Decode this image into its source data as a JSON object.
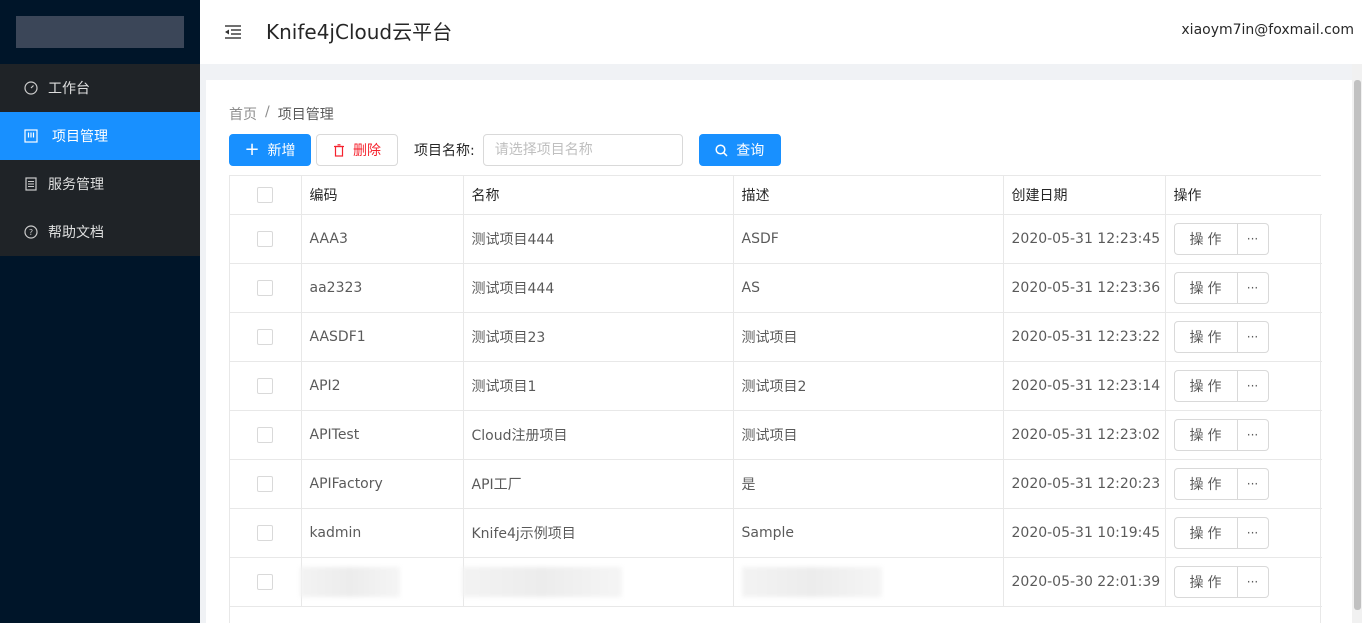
{
  "app": {
    "title": "Knife4jCloud云平台",
    "user": "xiaoym7in@foxmail.com"
  },
  "sidebar": {
    "items": [
      {
        "label": "工作台",
        "icon": "dashboard-icon",
        "active": false
      },
      {
        "label": "项目管理",
        "icon": "project-icon",
        "active": true
      },
      {
        "label": "服务管理",
        "icon": "service-icon",
        "active": false
      },
      {
        "label": "帮助文档",
        "icon": "help-icon",
        "active": false
      }
    ]
  },
  "breadcrumb": {
    "home": "首页",
    "sep": "/",
    "current": "项目管理"
  },
  "toolbar": {
    "add_label": "新增",
    "delete_label": "删除",
    "name_label": "项目名称:",
    "name_placeholder": "请选择项目名称",
    "query_label": "查询"
  },
  "table": {
    "columns": [
      "编码",
      "名称",
      "描述",
      "创建日期",
      "操作"
    ],
    "op_label": "操作",
    "more_label": "···",
    "rows": [
      {
        "code": "AAA3",
        "name": "测试项目444",
        "desc": "ASDF",
        "date": "2020-05-31 12:23:45"
      },
      {
        "code": "aa2323",
        "name": "测试项目444",
        "desc": "AS",
        "date": "2020-05-31 12:23:36"
      },
      {
        "code": "AASDF1",
        "name": "测试项目23",
        "desc": "测试项目",
        "date": "2020-05-31 12:23:22"
      },
      {
        "code": "API2",
        "name": "测试项目1",
        "desc": "测试项目2",
        "date": "2020-05-31 12:23:14"
      },
      {
        "code": "APITest",
        "name": "Cloud注册项目",
        "desc": "测试项目",
        "date": "2020-05-31 12:23:02"
      },
      {
        "code": "APIFactory",
        "name": "API工厂",
        "desc": "是",
        "date": "2020-05-31 12:20:23"
      },
      {
        "code": "kadmin",
        "name": "Knife4j示例项目",
        "desc": "Sample",
        "date": "2020-05-31 10:19:45"
      },
      {
        "code": "",
        "name": "",
        "desc": "",
        "date": "2020-05-30 22:01:39"
      }
    ]
  },
  "colors": {
    "primary": "#1890ff",
    "danger": "#f5222d",
    "sider": "#001529",
    "menu": "#1f2327"
  }
}
